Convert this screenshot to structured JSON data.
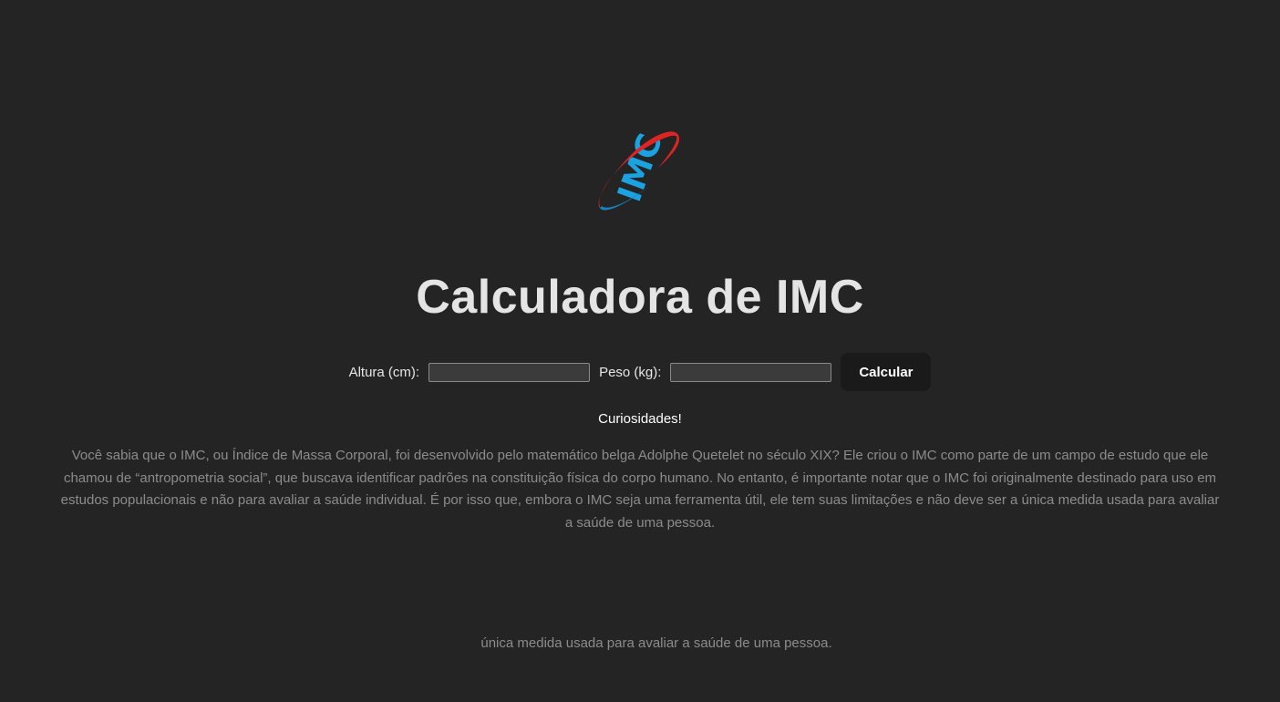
{
  "logo": {
    "text": "IMC",
    "icon": "imc-logo-icon",
    "colors": {
      "text": "#1aa3e0",
      "swoosh": "#e02424",
      "swoosh_edge": "#1a7fc0"
    }
  },
  "header": {
    "title": "Calculadora de IMC"
  },
  "form": {
    "height_label": "Altura (cm):",
    "height_value": "",
    "weight_label": "Peso (kg):",
    "weight_value": "",
    "calculate_label": "Calcular"
  },
  "curiosities": {
    "heading": "Curiosidades!",
    "text": "Você sabia que o IMC, ou Índice de Massa Corporal, foi desenvolvido pelo matemático belga Adolphe Quetelet no século XIX? Ele criou o IMC como parte de um campo de estudo que ele chamou de “antropometria social”, que buscava identificar padrões na constituição física do corpo humano. No entanto, é importante notar que o IMC foi originalmente destinado para uso em estudos populacionais e não para avaliar a saúde individual. É por isso que, embora o IMC seja uma ferramenta útil, ele tem suas limitações e não deve ser a única medida usada para avaliar a saúde de uma pessoa."
  },
  "footer": {
    "text": "única medida usada para avaliar a saúde de uma pessoa."
  },
  "theme": {
    "background": "#242424",
    "title_color": "#e4e4e4",
    "muted_text": "#8c8c8c",
    "button_bg": "#1a1a1a",
    "input_bg": "#3b3b3b"
  }
}
